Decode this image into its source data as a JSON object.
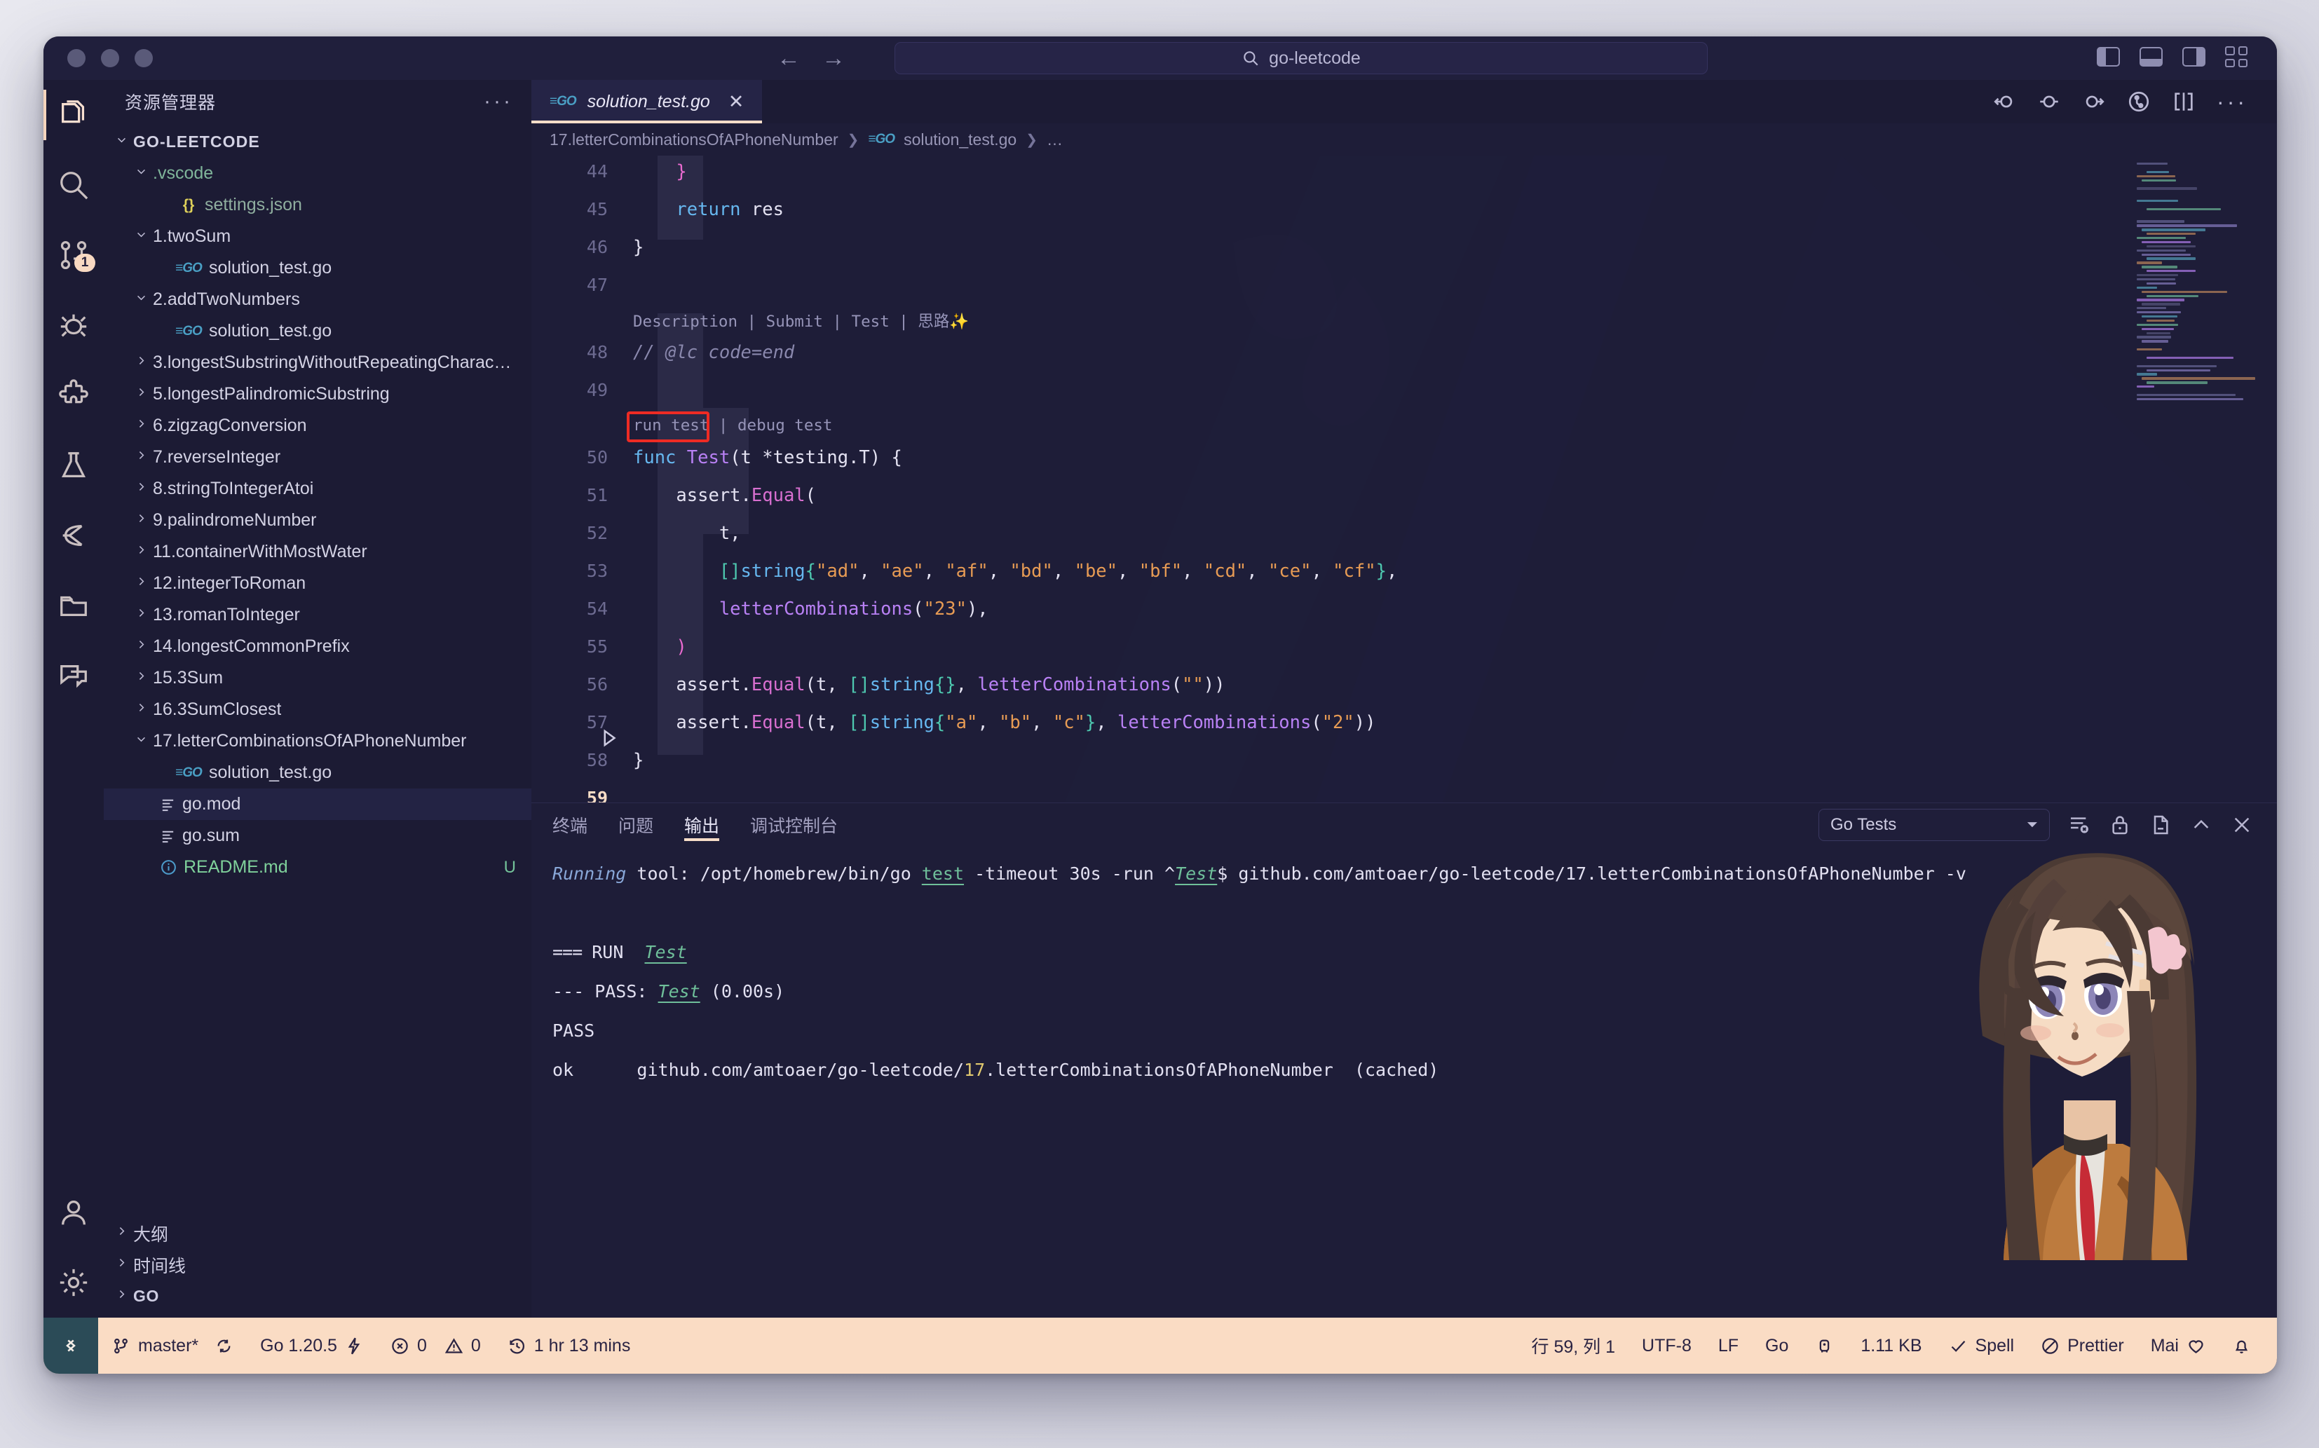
{
  "titlebar": {
    "quick_open_value": "go-leetcode",
    "search_icon": "search-icon",
    "back_icon": "arrow-left-icon",
    "forward_icon": "arrow-right-icon",
    "layout_icons": [
      "toggle-primary-sidebar-icon",
      "toggle-panel-icon",
      "toggle-secondary-sidebar-icon",
      "customize-layout-icon"
    ]
  },
  "activitybar": {
    "items": [
      {
        "name": "explorer",
        "icon": "files-icon",
        "active": true,
        "badge": ""
      },
      {
        "name": "search",
        "icon": "search-icon",
        "active": false,
        "badge": ""
      },
      {
        "name": "source-control",
        "icon": "source-control-icon",
        "active": false,
        "badge": "1"
      },
      {
        "name": "run-and-debug",
        "icon": "debug-icon",
        "active": false,
        "badge": ""
      },
      {
        "name": "extensions",
        "icon": "extensions-icon",
        "active": false,
        "badge": ""
      },
      {
        "name": "testing",
        "icon": "beaker-icon",
        "active": false,
        "badge": ""
      },
      {
        "name": "leetcode",
        "icon": "leetcode-icon",
        "active": false,
        "badge": ""
      },
      {
        "name": "remote-explorer",
        "icon": "folder-icon",
        "active": false,
        "badge": ""
      },
      {
        "name": "chat",
        "icon": "comment-icon",
        "active": false,
        "badge": ""
      }
    ],
    "bottom": [
      {
        "name": "accounts",
        "icon": "account-icon"
      },
      {
        "name": "manage",
        "icon": "gear-icon"
      }
    ]
  },
  "sidebar": {
    "title": "资源管理器",
    "more_label": "···",
    "tree": [
      {
        "label": "GO-LEETCODE",
        "depth": 0,
        "chev": "down",
        "kind": "root"
      },
      {
        "label": ".vscode",
        "depth": 1,
        "chev": "down",
        "kind": "folder-vscode"
      },
      {
        "label": "settings.json",
        "depth": 2,
        "chev": "none",
        "kind": "json"
      },
      {
        "label": "1.twoSum",
        "depth": 1,
        "chev": "down",
        "kind": "folder"
      },
      {
        "label": "solution_test.go",
        "depth": 2,
        "chev": "none",
        "kind": "go"
      },
      {
        "label": "2.addTwoNumbers",
        "depth": 1,
        "chev": "down",
        "kind": "folder"
      },
      {
        "label": "solution_test.go",
        "depth": 2,
        "chev": "none",
        "kind": "go"
      },
      {
        "label": "3.longestSubstringWithoutRepeatingCharact…",
        "depth": 1,
        "chev": "right",
        "kind": "folder"
      },
      {
        "label": "5.longestPalindromicSubstring",
        "depth": 1,
        "chev": "right",
        "kind": "folder"
      },
      {
        "label": "6.zigzagConversion",
        "depth": 1,
        "chev": "right",
        "kind": "folder"
      },
      {
        "label": "7.reverseInteger",
        "depth": 1,
        "chev": "right",
        "kind": "folder"
      },
      {
        "label": "8.stringToIntegerAtoi",
        "depth": 1,
        "chev": "right",
        "kind": "folder"
      },
      {
        "label": "9.palindromeNumber",
        "depth": 1,
        "chev": "right",
        "kind": "folder"
      },
      {
        "label": "11.containerWithMostWater",
        "depth": 1,
        "chev": "right",
        "kind": "folder"
      },
      {
        "label": "12.integerToRoman",
        "depth": 1,
        "chev": "right",
        "kind": "folder"
      },
      {
        "label": "13.romanToInteger",
        "depth": 1,
        "chev": "right",
        "kind": "folder"
      },
      {
        "label": "14.longestCommonPrefix",
        "depth": 1,
        "chev": "right",
        "kind": "folder"
      },
      {
        "label": "15.3Sum",
        "depth": 1,
        "chev": "right",
        "kind": "folder"
      },
      {
        "label": "16.3SumClosest",
        "depth": 1,
        "chev": "right",
        "kind": "folder"
      },
      {
        "label": "17.letterCombinationsOfAPhoneNumber",
        "depth": 1,
        "chev": "down",
        "kind": "folder"
      },
      {
        "label": "solution_test.go",
        "depth": 2,
        "chev": "none",
        "kind": "go"
      },
      {
        "label": "go.mod",
        "depth": 1,
        "chev": "none",
        "kind": "lines",
        "selected": true
      },
      {
        "label": "go.sum",
        "depth": 1,
        "chev": "none",
        "kind": "lines"
      },
      {
        "label": "README.md",
        "depth": 1,
        "chev": "none",
        "kind": "info",
        "git": "U",
        "color": "green"
      }
    ],
    "bottom_sections": [
      {
        "label": "大纲",
        "chev": "right",
        "bold": false
      },
      {
        "label": "时间线",
        "chev": "right",
        "bold": false
      },
      {
        "label": "GO",
        "chev": "right",
        "bold": true
      }
    ]
  },
  "editor": {
    "tab": {
      "label": "solution_test.go",
      "icon": "go-file-icon",
      "close_icon": "close-icon",
      "dirty": false
    },
    "breadcrumb": [
      "17.letterCombinationsOfAPhoneNumber",
      "solution_test.go",
      "…"
    ],
    "actions": [
      "go-test-previous-icon",
      "go-test-current-icon",
      "go-test-next-icon",
      "source-control-graph-icon",
      "split-editor-icon",
      "more-actions-icon"
    ],
    "codelens_top": "Description | Submit | Test | 思路✨",
    "codelens_run": "run test",
    "codelens_sep": "|",
    "codelens_debug": "debug test",
    "active_line": 59,
    "lines": [
      {
        "n": 44,
        "text": "    }"
      },
      {
        "n": 45,
        "text": "    return res"
      },
      {
        "n": 46,
        "text": "}"
      },
      {
        "n": 47,
        "text": ""
      },
      {
        "n": 48,
        "text": "// @lc code=end"
      },
      {
        "n": 49,
        "text": ""
      },
      {
        "n": 50,
        "text": "func Test(t *testing.T) {"
      },
      {
        "n": 51,
        "text": "    assert.Equal("
      },
      {
        "n": 52,
        "text": "        t,"
      },
      {
        "n": 53,
        "text": "        []string{\"ad\", \"ae\", \"af\", \"bd\", \"be\", \"bf\", \"cd\", \"ce\", \"cf\"},"
      },
      {
        "n": 54,
        "text": "        letterCombinations(\"23\"),"
      },
      {
        "n": 55,
        "text": "    )"
      },
      {
        "n": 56,
        "text": "    assert.Equal(t, []string{}, letterCombinations(\"\"))"
      },
      {
        "n": 57,
        "text": "    assert.Equal(t, []string{\"a\", \"b\", \"c\"}, letterCombinations(\"2\"))"
      },
      {
        "n": 58,
        "text": "}"
      },
      {
        "n": 59,
        "text": ""
      }
    ]
  },
  "panel": {
    "tabs": [
      {
        "label": "终端",
        "active": false
      },
      {
        "label": "问题",
        "active": false
      },
      {
        "label": "输出",
        "active": true
      },
      {
        "label": "调试控制台",
        "active": false
      }
    ],
    "channel": "Go Tests",
    "channel_chevron": "chevron-down-icon",
    "actions": [
      "clear-output-icon",
      "lock-scroll-icon",
      "open-in-editor-icon",
      "maximize-panel-icon",
      "close-panel-icon"
    ],
    "output": {
      "running_prefix": "Running",
      "running_rest": " tool: /opt/homebrew/bin/go ",
      "running_test_link": "test",
      "running_mid": " -timeout 30s -run ^",
      "running_testlink2": "Test",
      "running_tail": "$ github.com/amtoaer/go-leetcode/17.letterCombinationsOfAPhoneNumber -v",
      "run_marker": "=== ",
      "run_label": "RUN",
      "run_test": "Test",
      "pass_prefix": "--- PASS: ",
      "pass_test": "Test",
      "pass_time": " (0.00s)",
      "pass_line": "PASS",
      "ok_label": "ok",
      "ok_pkg_prefix": "github.com/amtoaer/go-leetcode/",
      "ok_pkg_num": "17",
      "ok_pkg_rest": ".letterCombinationsOfAPhoneNumber",
      "ok_cached": "(cached)"
    }
  },
  "statusbar": {
    "remote_icon": "remote-window-icon",
    "branch": "master*",
    "branch_icon": "source-control-branch-icon",
    "sync_icon": "sync-icon",
    "go_version": "Go 1.20.5",
    "go_version_icon": "zap-icon",
    "errors": "0",
    "errors_icon": "error-circle-icon",
    "warnings": "0",
    "warnings_icon": "warning-triangle-icon",
    "time_tracked": "1 hr 13 mins",
    "time_icon": "history-icon",
    "cursor_position": "行 59, 列 1",
    "encoding": "UTF-8",
    "eol": "LF",
    "language": "Go",
    "tray_icon": "go-nightly-icon",
    "filesize": "1.11 KB",
    "spell": "Spell",
    "spell_icon": "check-icon",
    "prettier": "Prettier",
    "prettier_icon": "prohibited-icon",
    "mai": "Mai",
    "mai_icon": "heart-icon",
    "bell_icon": "bell-icon"
  },
  "colors": {
    "window_bg": "#1c1b34",
    "editor_bg": "#1e1d38",
    "tab_active_bg": "#252446",
    "accent": "#f7ddc8",
    "status_bg": "#fadcc4",
    "highlight_red": "#ee2b24",
    "go_blue": "#4a9fc4",
    "badge_bg": "#f8d9c2",
    "git_untracked": "#74c39a"
  }
}
